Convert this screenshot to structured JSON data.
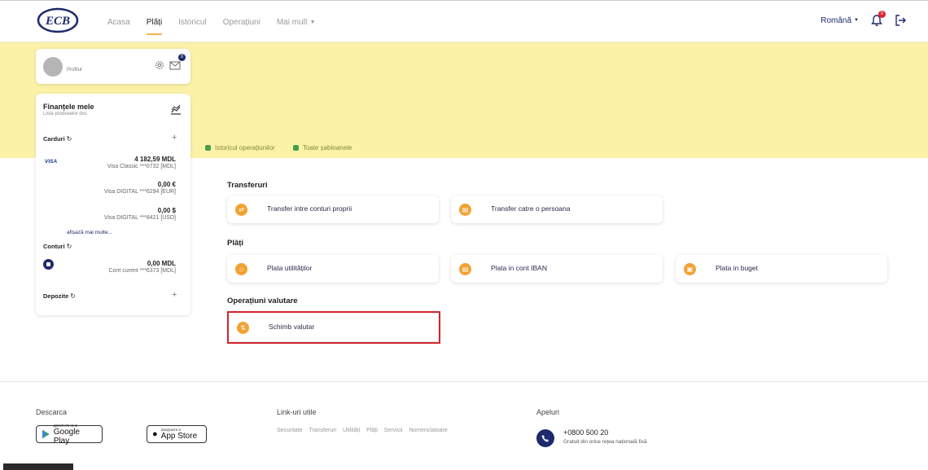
{
  "header": {
    "logo_text": "ECB",
    "nav": [
      {
        "label": "Acasa"
      },
      {
        "label": "Plăți"
      },
      {
        "label": "Istoricul"
      },
      {
        "label": "Operațiuni"
      },
      {
        "label": "Mai mult"
      }
    ],
    "language": "Română",
    "notification_count": "0"
  },
  "profile": {
    "label": "Profilul",
    "message_count": "0"
  },
  "finances": {
    "title": "Finanțele mele",
    "subtitle": "Lista produselor dvs",
    "cards_label": "Carduri",
    "cards": [
      {
        "brand": "VISA",
        "amount": "4 182,59 MDL",
        "desc": "Visa Classic ***0732 [MDL]"
      },
      {
        "amount": "0,00 €",
        "desc": "Visa DIGITAL ***6294 [EUR]"
      },
      {
        "amount": "0,00 $",
        "desc": "Visa DIGITAL ***8421 [USD]"
      }
    ],
    "more_link": "afișază mai multe...",
    "accounts_label": "Conturi",
    "accounts": [
      {
        "amount": "0,00 MDL",
        "desc": "Cont curent ***6373 [MDL]"
      }
    ],
    "deposits_label": "Depozite"
  },
  "quick_links": [
    "Istoricul operațiunilor",
    "Toate șabloanele"
  ],
  "sections": {
    "transfers_title": "Transferuri",
    "transfers": [
      "Transfer intre conturi proprii",
      "Transfer catre o persoana"
    ],
    "payments_title": "Plăți",
    "payments": [
      "Plata utilităților",
      "Plata in cont IBAN",
      "Plata in buget"
    ],
    "fx_title": "Operațiuni valutare",
    "fx": [
      "Schimb valutar"
    ]
  },
  "footer": {
    "download_title": "Descarca",
    "google_small": "ДОСТУПНО В",
    "google_big": "Google Play",
    "apple_small": "Загрузите в",
    "apple_big": "App Store",
    "links_title": "Link-uri utile",
    "links": [
      "Securitate",
      "Transferuri",
      "Utilități",
      "Plăți",
      "Servicii",
      "Nomenclatoare"
    ],
    "calls_title": "Apeluri",
    "phone": "+0800 500 20",
    "phone_note": "Gratuit din orice rețea națională fixă"
  },
  "colors": {
    "band": "#fbf2a7",
    "accent": "#f2a234",
    "brand_navy": "#1e2a6e",
    "highlight": "#d0262f"
  }
}
